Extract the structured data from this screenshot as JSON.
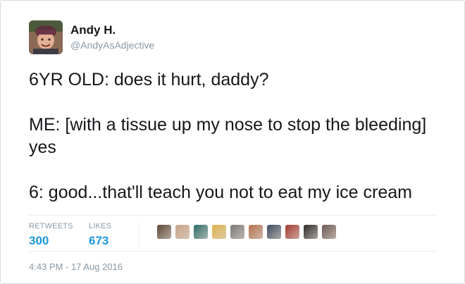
{
  "author": {
    "display_name": "Andy H.",
    "handle": "@AndyAsAdjective"
  },
  "tweet": {
    "lines": [
      "6YR OLD: does it hurt, daddy?",
      "ME: [with a tissue up my nose to stop the bleeding] yes",
      "6: good...that'll teach you not to eat my ice cream"
    ]
  },
  "stats": {
    "retweets_label": "RETWEETS",
    "retweets_value": "300",
    "likes_label": "LIKES",
    "likes_value": "673"
  },
  "likers": [
    {
      "color": "#5a4636"
    },
    {
      "color": "#c9a58a"
    },
    {
      "color": "#2c6e6a"
    },
    {
      "color": "#e0b34b"
    },
    {
      "color": "#7a7a7a"
    },
    {
      "color": "#b5734e"
    },
    {
      "color": "#3d4c5f"
    },
    {
      "color": "#a43b2f"
    },
    {
      "color": "#2b2b2b"
    },
    {
      "color": "#6d5a55"
    }
  ],
  "timestamp": "4:43 PM - 17 Aug 2016",
  "colors": {
    "accent": "#1b95e0",
    "muted": "#8899a6",
    "text": "#14171a"
  }
}
